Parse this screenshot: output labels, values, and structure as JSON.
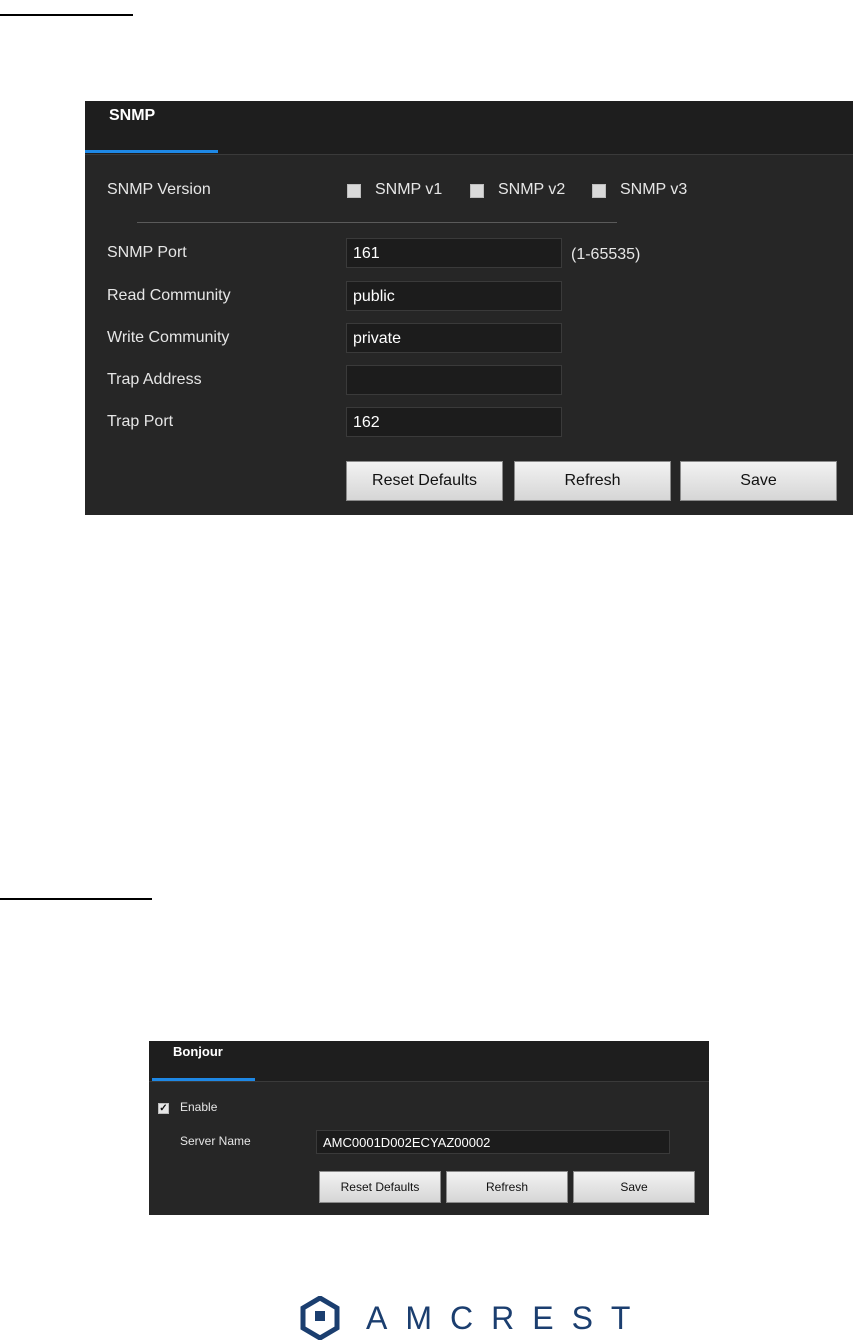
{
  "snmp_panel": {
    "tab": "SNMP",
    "version_label": "SNMP Version",
    "versions": [
      {
        "label": "SNMP v1",
        "checked": false
      },
      {
        "label": "SNMP v2",
        "checked": false
      },
      {
        "label": "SNMP v3",
        "checked": false
      }
    ],
    "port_label": "SNMP Port",
    "port_value": "161",
    "port_hint": "(1-65535)",
    "read_label": "Read Community",
    "read_value": "public",
    "write_label": "Write Community",
    "write_value": "private",
    "trap_address_label": "Trap Address",
    "trap_address_value": "",
    "trap_port_label": "Trap Port",
    "trap_port_value": "162",
    "reset_label": "Reset Defaults",
    "refresh_label": "Refresh",
    "save_label": "Save"
  },
  "bonjour_panel": {
    "tab": "Bonjour",
    "enable_label": "Enable",
    "enable_checked": true,
    "server_name_label": "Server Name",
    "server_name_value": "AMC0001D002ECYAZ00002",
    "reset_label": "Reset Defaults",
    "refresh_label": "Refresh",
    "save_label": "Save"
  },
  "logo": {
    "brand": "AMCREST",
    "icon": "amcrest-hexagon-icon",
    "color": "#1b3e6f"
  },
  "accent_color": "#1e88e5"
}
